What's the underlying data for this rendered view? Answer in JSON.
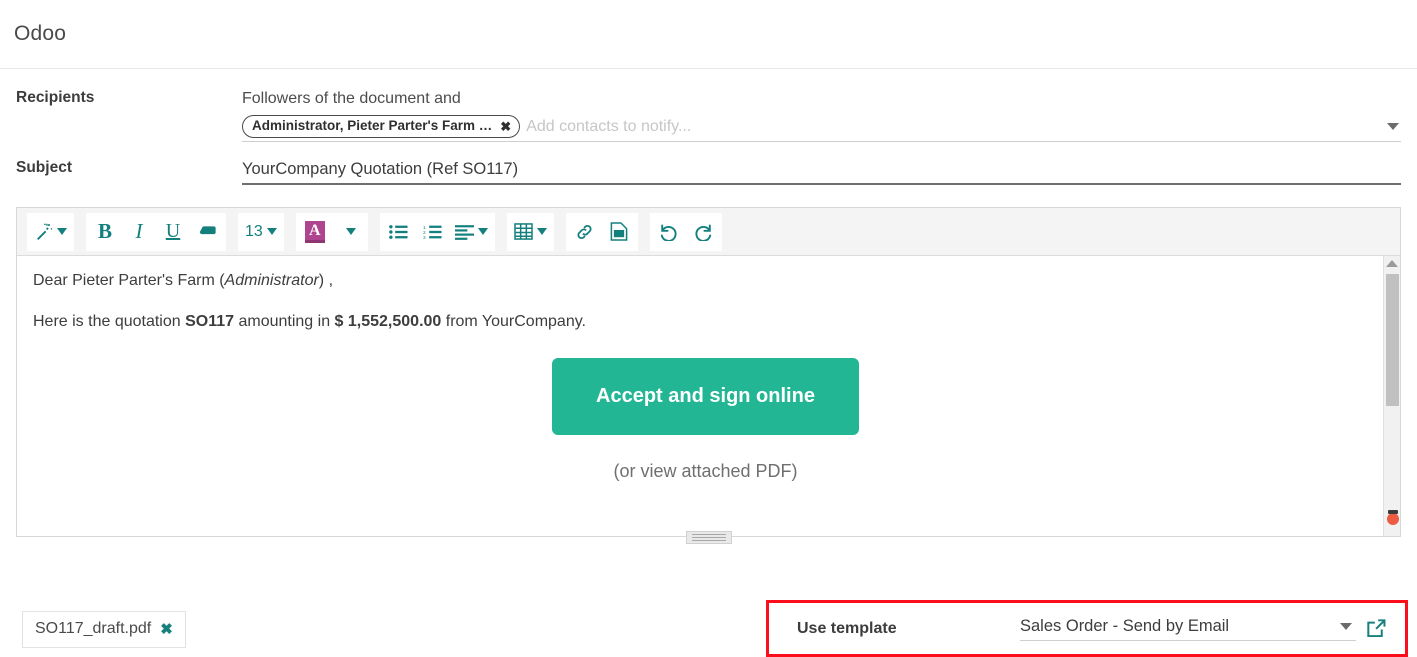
{
  "header": {
    "title": "Odoo"
  },
  "recipients": {
    "label": "Recipients",
    "static_text": "Followers of the document and",
    "tag": "Administrator, Pieter Parter's Farm …",
    "tag_remove_icon": "close-icon",
    "placeholder": "Add contacts to notify...",
    "dropdown_icon": "chevron-down-icon"
  },
  "subject": {
    "label": "Subject",
    "value": "YourCompany Quotation (Ref SO117)"
  },
  "toolbar": {
    "magic_wand": "magic-wand",
    "bold": "B",
    "italic": "I",
    "underline": "U",
    "eraser": "remove-format",
    "font_size": "13",
    "font_color": "A",
    "bullet_list": "unordered-list",
    "numbered_list": "ordered-list",
    "align": "align-left",
    "table": "table",
    "link": "link",
    "image": "image",
    "undo": "undo",
    "redo": "redo"
  },
  "body": {
    "greeting_prefix": "Dear Pieter Parter's Farm (",
    "greeting_italic": "Administrator",
    "greeting_suffix": ") ,",
    "line2_a": "Here is the quotation ",
    "line2_ref": "SO117",
    "line2_b": " amounting in ",
    "line2_amount": "$ 1,552,500.00",
    "line2_c": " from YourCompany.",
    "cta_label": "Accept and sign online",
    "pdf_note": "(or view attached PDF)"
  },
  "attachment": {
    "filename": "SO117_draft.pdf",
    "remove_icon": "close-icon"
  },
  "template": {
    "label": "Use template",
    "value": "Sales Order - Send by Email",
    "dropdown_icon": "chevron-down-icon",
    "external_icon": "external-link-icon"
  },
  "colors": {
    "accent_teal": "#14807e",
    "cta_green": "#23b695",
    "color_a_magenta": "#b0458f",
    "highlight_red": "#fc0d1c"
  }
}
